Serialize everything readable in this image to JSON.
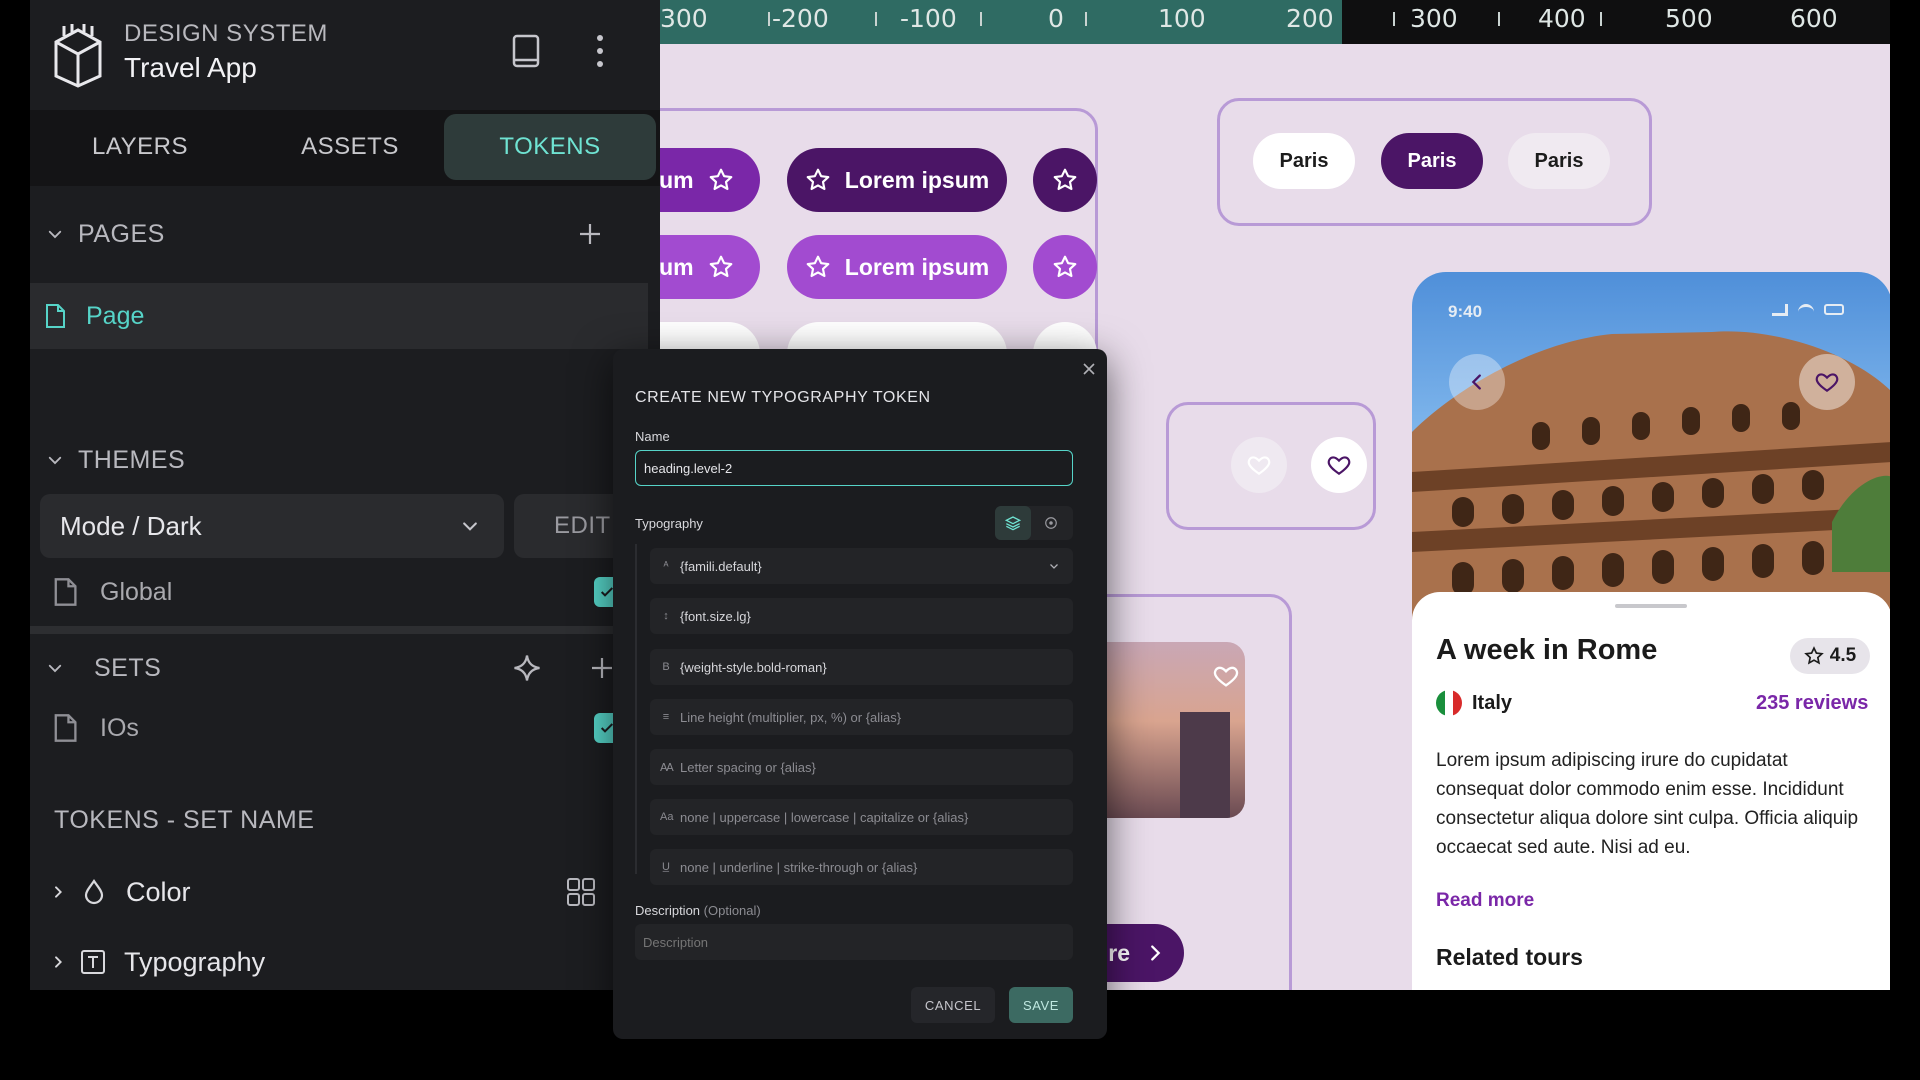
{
  "app": {
    "brand_label": "DESIGN SYSTEM",
    "project_name": "Travel App"
  },
  "tabs": [
    {
      "label": "LAYERS",
      "active": false
    },
    {
      "label": "ASSETS",
      "active": false
    },
    {
      "label": "TOKENS",
      "active": true
    }
  ],
  "pages": {
    "title": "PAGES",
    "items": [
      {
        "label": "Page"
      }
    ]
  },
  "themes": {
    "title": "THEMES",
    "selected": "Mode / Dark",
    "edit_label": "EDIT",
    "items": [
      {
        "label": "Global",
        "checked": true
      }
    ]
  },
  "sets": {
    "title": "SETS",
    "items": [
      {
        "label": "IOs",
        "checked": true
      }
    ]
  },
  "tokens": {
    "title": "TOKENS - SET NAME",
    "groups": [
      {
        "label": "Color",
        "icon": "drop-icon"
      },
      {
        "label": "Typography",
        "icon": "text-icon"
      }
    ]
  },
  "ruler": {
    "labels": [
      "300",
      "-200",
      "-100",
      "0",
      "100",
      "200",
      "300",
      "400",
      "500",
      "600"
    ]
  },
  "canvas": {
    "button_label": "Lorem ipsum",
    "button_label_cut": "sum",
    "chips": [
      "Paris",
      "Paris",
      "Paris"
    ],
    "more_cut": "re"
  },
  "phone": {
    "time": "9:40",
    "title": "A week in Rome",
    "rating": "4.5",
    "country": "Italy",
    "reviews": "235 reviews",
    "description": "Lorem ipsum adipiscing irure do cupidatat consequat dolor commodo enim esse. Incididunt consectetur aliqua dolore sint culpa. Officia aliquip occaecat sed aute. Nisi ad eu.",
    "read_more": "Read more",
    "related": "Related tours"
  },
  "modal": {
    "title": "CREATE NEW TYPOGRAPHY TOKEN",
    "name_label": "Name",
    "name_value": "heading.level-2",
    "typography_label": "Typography",
    "fields": {
      "family": "{famili.default}",
      "size": "{font.size.lg}",
      "weight": "{weight-style.bold-roman}",
      "line_height": "Line height (multiplier, px, %) or {alias}",
      "letter_spacing": "Letter spacing or {alias}",
      "text_case": "none | uppercase | lowercase | capitalize or {alias}",
      "decoration": "none | underline | strike-through or {alias}"
    },
    "description_label": "Description",
    "description_optional": "(Optional)",
    "description_placeholder": "Description",
    "cancel_label": "CANCEL",
    "save_label": "SAVE"
  },
  "colors": {
    "accent": "#56d4c8",
    "purple": "#7a27a8",
    "purple_dark": "#4b1566"
  }
}
